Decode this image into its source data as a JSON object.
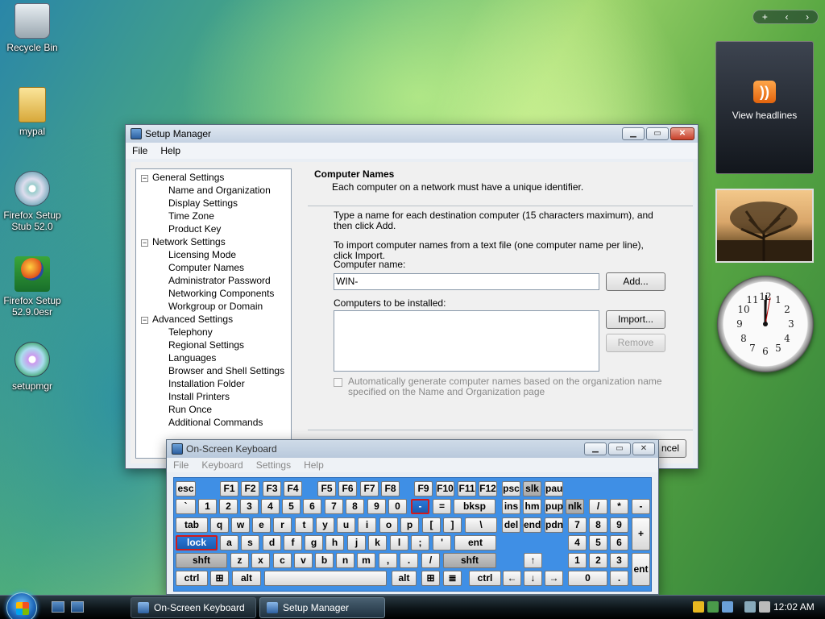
{
  "desktop": {
    "icons": [
      {
        "label": "Recycle Bin"
      },
      {
        "label": "mypal"
      },
      {
        "label": "Firefox Setup Stub 52.0"
      },
      {
        "label": "Firefox Setup 52.9.0esr"
      },
      {
        "label": "setupmgr"
      }
    ]
  },
  "gadgets": {
    "bar": {
      "add": "+",
      "prev": "‹",
      "next": "›"
    },
    "headlines": "View headlines",
    "rss_symbol": "))"
  },
  "setup_manager": {
    "title": "Setup Manager",
    "menu": [
      "File",
      "Help"
    ],
    "tree": [
      {
        "label": "General Settings",
        "level": 1,
        "expander": "−"
      },
      {
        "label": "Name and Organization",
        "level": 2
      },
      {
        "label": "Display Settings",
        "level": 2
      },
      {
        "label": "Time Zone",
        "level": 2
      },
      {
        "label": "Product Key",
        "level": 2
      },
      {
        "label": "Network Settings",
        "level": 1,
        "expander": "−"
      },
      {
        "label": "Licensing Mode",
        "level": 2
      },
      {
        "label": "Computer Names",
        "level": 2
      },
      {
        "label": "Administrator Password",
        "level": 2
      },
      {
        "label": "Networking Components",
        "level": 2
      },
      {
        "label": "Workgroup or Domain",
        "level": 2
      },
      {
        "label": "Advanced Settings",
        "level": 1,
        "expander": "−"
      },
      {
        "label": "Telephony",
        "level": 2
      },
      {
        "label": "Regional Settings",
        "level": 2
      },
      {
        "label": "Languages",
        "level": 2
      },
      {
        "label": "Browser and Shell Settings",
        "level": 2
      },
      {
        "label": "Installation Folder",
        "level": 2
      },
      {
        "label": "Install Printers",
        "level": 2
      },
      {
        "label": "Run Once",
        "level": 2
      },
      {
        "label": "Additional Commands",
        "level": 2
      }
    ],
    "panel": {
      "heading": "Computer Names",
      "subheading": "Each computer on a network must have a unique identifier.",
      "instruction1": "Type a name for each destination computer (15 characters maximum), and then click Add.",
      "instruction2": "To import computer names from a text file (one computer name per line), click Import.",
      "name_label": "Computer name:",
      "name_value": "WIN-",
      "list_label": "Computers to be installed:",
      "add_button": "Add...",
      "import_button": "Import...",
      "remove_button": "Remove",
      "auto_checkbox": "Automatically generate computer names based on the organization name specified on the Name and Organization page",
      "cancel_partial": "ncel"
    }
  },
  "osk": {
    "title": "On-Screen Keyboard",
    "menu": [
      "File",
      "Keyboard",
      "Settings",
      "Help"
    ],
    "rows": {
      "r1": [
        "esc",
        "F1",
        "F2",
        "F3",
        "F4",
        "F5",
        "F6",
        "F7",
        "F8",
        "F9",
        "F10",
        "F11",
        "F12",
        "psc",
        "slk",
        "pau"
      ],
      "r2": [
        "`",
        "1",
        "2",
        "3",
        "4",
        "5",
        "6",
        "7",
        "8",
        "9",
        "0",
        "-",
        "=",
        "bksp",
        "ins",
        "hm",
        "pup",
        "nlk",
        "/",
        "*",
        "-"
      ],
      "r3": [
        "tab",
        "q",
        "w",
        "e",
        "r",
        "t",
        "y",
        "u",
        "i",
        "o",
        "p",
        "[",
        "]",
        "\\",
        "del",
        "end",
        "pdn",
        "7",
        "8",
        "9",
        "+"
      ],
      "r4": [
        "lock",
        "a",
        "s",
        "d",
        "f",
        "g",
        "h",
        "j",
        "k",
        "l",
        ";",
        "'",
        "ent",
        "4",
        "5",
        "6"
      ],
      "r5": [
        "shft",
        "z",
        "x",
        "c",
        "v",
        "b",
        "n",
        "m",
        ",",
        ".",
        "/",
        "shft",
        "↑",
        "1",
        "2",
        "3",
        "ent"
      ],
      "r6": [
        "ctrl",
        "⊞",
        "alt",
        "",
        "alt",
        "⊞",
        "≣",
        "ctrl",
        "←",
        "↓",
        "→",
        "0",
        "."
      ]
    }
  },
  "taskbar": {
    "buttons": [
      "On-Screen Keyboard",
      "Setup Manager"
    ],
    "time": "12:02 AM"
  }
}
